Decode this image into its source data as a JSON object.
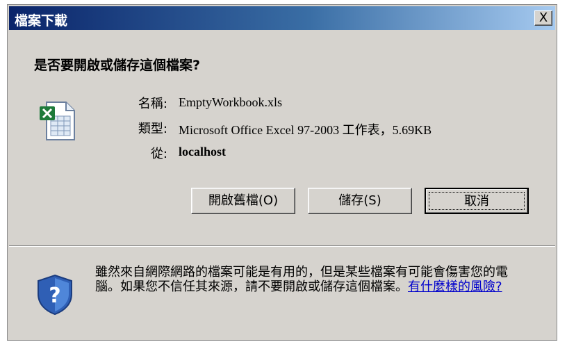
{
  "window": {
    "title": "檔案下載",
    "close_label": "X"
  },
  "question": "是否要開啟或儲存這個檔案?",
  "file_info": {
    "name_label": "名稱:",
    "name_value": "EmptyWorkbook.xls",
    "type_label": "類型:",
    "type_value": "Microsoft Office Excel 97-2003 工作表，5.69KB",
    "from_label": "從:",
    "from_value": "localhost",
    "icon": "excel-file-icon"
  },
  "buttons": {
    "open": "開啟舊檔(O)",
    "save": "儲存(S)",
    "cancel": "取消"
  },
  "warning": {
    "text": "雖然來自網際網路的檔案可能是有用的，但是某些檔案有可能會傷害您的電腦。如果您不信任其來源，請不要開啟或儲存這個檔案。",
    "link": "有什麼樣的風險?",
    "icon": "security-shield-icon"
  },
  "colors": {
    "dialog_bg": "#d6d3ce",
    "title_start": "#0a246a",
    "title_end": "#a6caf0",
    "link": "#0000cc"
  }
}
